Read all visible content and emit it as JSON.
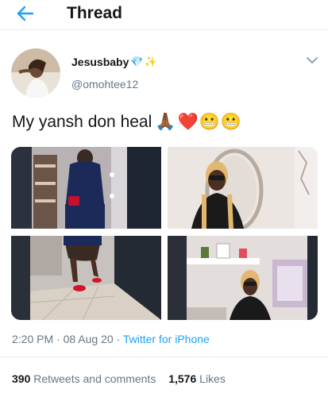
{
  "header": {
    "title": "Thread"
  },
  "tweet": {
    "display_name": "Jesusbaby",
    "name_emojis": [
      "💎",
      "✨"
    ],
    "handle": "@omohtee12",
    "text": "My yansh don heal",
    "emojis": [
      "🙏🏾",
      "",
      "❤️",
      "😬",
      "😬"
    ],
    "time": "2:20 PM",
    "date": "08 Aug 20",
    "source": "Twitter for iPhone",
    "separator": "·"
  },
  "stats": {
    "retweets_count": "390",
    "retweets_label": "Retweets and comments",
    "likes_count": "1,576",
    "likes_label": "Likes"
  },
  "colors": {
    "accent": "#1da1f2",
    "text_primary": "#14171a",
    "text_secondary": "#657786",
    "divider": "#e6ecf0"
  },
  "icons": {
    "back": "arrow-left-icon",
    "menu": "chevron-down-icon"
  }
}
